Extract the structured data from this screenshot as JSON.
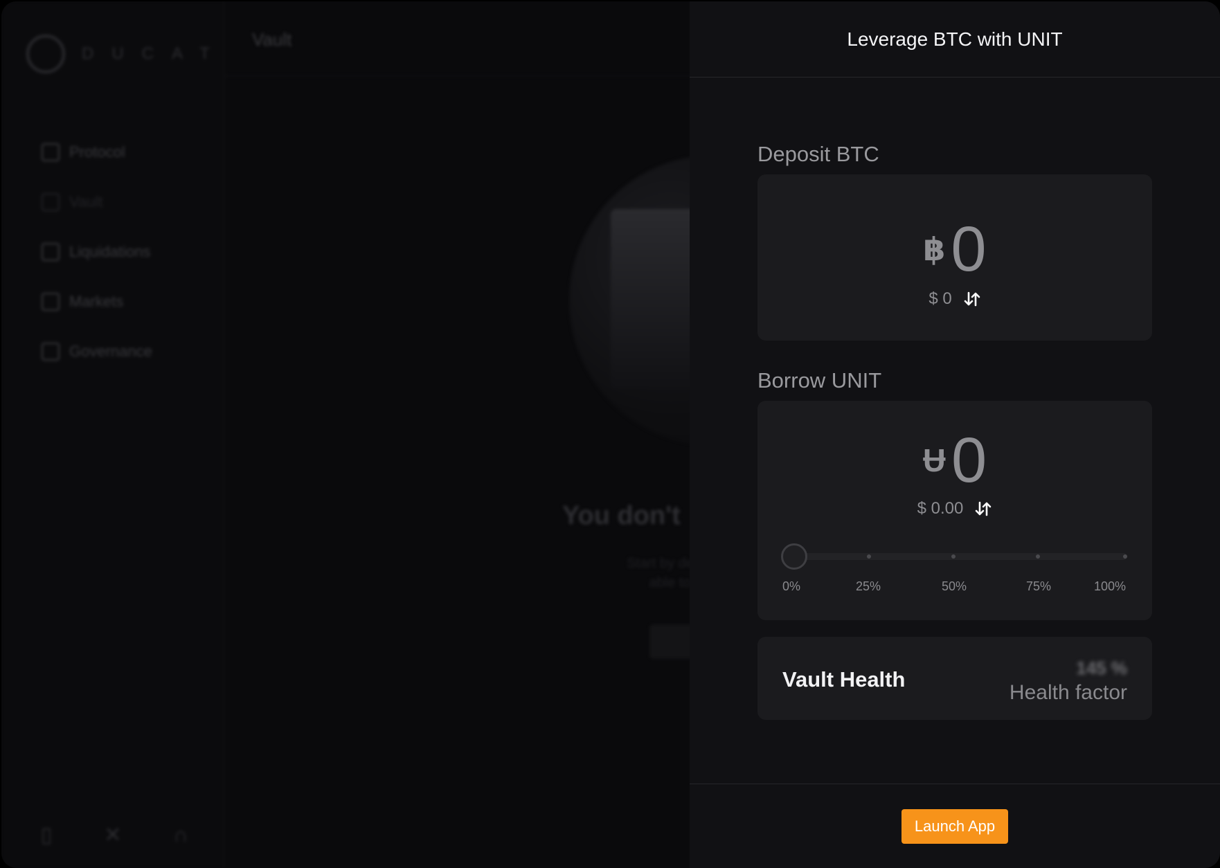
{
  "background": {
    "logo_text": "DUCAT",
    "header_title": "Vault",
    "nav": [
      {
        "label": "Protocol",
        "icon": "grid-icon"
      },
      {
        "label": "Vault",
        "icon": "vault-icon"
      },
      {
        "label": "Liquidations",
        "icon": "liquidations-icon"
      },
      {
        "label": "Markets",
        "icon": "chart-icon"
      },
      {
        "label": "Governance",
        "icon": "governance-icon"
      }
    ],
    "empty_title": "You don't",
    "empty_sub_1": "Start by depositing",
    "empty_sub_2": "able to borr"
  },
  "panel": {
    "title": "Leverage BTC with UNIT",
    "deposit": {
      "label": "Deposit BTC",
      "currency_symbol": "฿",
      "amount": "0",
      "fiat": "$ 0"
    },
    "borrow": {
      "label": "Borrow UNIT",
      "currency_symbol": "Ʉ",
      "amount": "0",
      "fiat": "$ 0.00",
      "slider_value_percent": 0,
      "ticks": [
        "0%",
        "25%",
        "50%",
        "75%",
        "100%"
      ]
    },
    "health": {
      "title": "Vault Health",
      "value": "145 %",
      "label": "Health factor"
    },
    "launch_label": "Launch App"
  },
  "colors": {
    "accent": "#f7931a",
    "panel_bg": "#111114",
    "card_bg": "#1b1b1e"
  }
}
